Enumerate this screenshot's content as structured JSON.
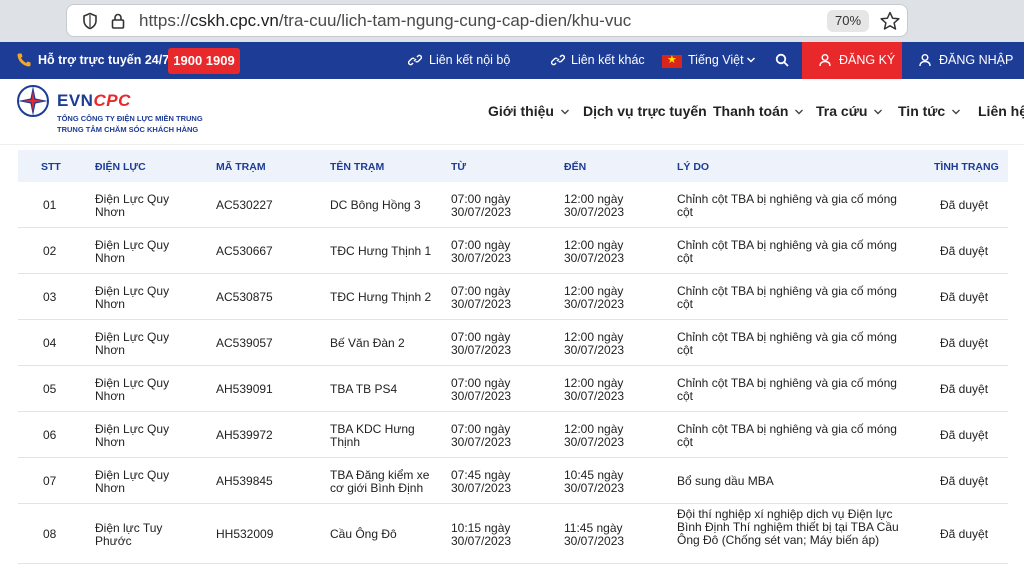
{
  "browser": {
    "url_prefix": "https://",
    "url_host": "cskh.cpc.vn",
    "url_path": "/tra-cuu/lich-tam-ngung-cung-cap-dien/khu-vuc",
    "zoom": "70%"
  },
  "topbar": {
    "support_label": "Hỗ trợ trực tuyến 24/7:",
    "hotline": "1900 1909",
    "internal_link": "Liên kết nội bộ",
    "other_link": "Liên kết khác",
    "language": "Tiếng Việt",
    "register": "ĐĂNG KÝ",
    "login": "ĐĂNG NHẬP"
  },
  "logo": {
    "evn": "EVN",
    "cpc": "CPC",
    "line1": "TỔNG CÔNG TY ĐIỆN LỰC MIỀN TRUNG",
    "line2": "TRUNG TÂM CHĂM SÓC KHÁCH HÀNG"
  },
  "nav": [
    {
      "label": "Giới thiệu"
    },
    {
      "label": "Dịch vụ trực tuyến"
    },
    {
      "label": "Thanh toán"
    },
    {
      "label": "Tra cứu"
    },
    {
      "label": "Tin tức"
    },
    {
      "label": "Liên hệ"
    }
  ],
  "table": {
    "headers": [
      "STT",
      "ĐIỆN LỰC",
      "MÃ TRẠM",
      "TÊN TRẠM",
      "TỪ",
      "ĐẾN",
      "LÝ DO",
      "TÌNH TRẠNG"
    ],
    "rows": [
      {
        "stt": "01",
        "dl1": "Điện Lực Quy",
        "dl2": "Nhơn",
        "ma": "AC530227",
        "ten1": "DC Bông Hồng 3",
        "ten2": "",
        "tu1": "07:00 ngày",
        "tu2": "30/07/2023",
        "den1": "12:00 ngày",
        "den2": "30/07/2023",
        "ld1": "Chỉnh cột TBA bị nghiêng và gia cố móng",
        "ld2": "cột",
        "ld3": "",
        "tt": "Đã duyệt"
      },
      {
        "stt": "02",
        "dl1": "Điện Lực Quy",
        "dl2": "Nhơn",
        "ma": "AC530667",
        "ten1": "TĐC Hưng Thịnh 1",
        "ten2": "",
        "tu1": "07:00 ngày",
        "tu2": "30/07/2023",
        "den1": "12:00 ngày",
        "den2": "30/07/2023",
        "ld1": "Chỉnh cột TBA bị nghiêng và gia cố móng",
        "ld2": "cột",
        "ld3": "",
        "tt": "Đã duyệt"
      },
      {
        "stt": "03",
        "dl1": "Điện Lực Quy",
        "dl2": "Nhơn",
        "ma": "AC530875",
        "ten1": "TĐC Hưng Thịnh 2",
        "ten2": "",
        "tu1": "07:00 ngày",
        "tu2": "30/07/2023",
        "den1": "12:00 ngày",
        "den2": "30/07/2023",
        "ld1": "Chỉnh cột TBA bị nghiêng và gia cố móng",
        "ld2": "cột",
        "ld3": "",
        "tt": "Đã duyệt"
      },
      {
        "stt": "04",
        "dl1": "Điện Lực Quy",
        "dl2": "Nhơn",
        "ma": "AC539057",
        "ten1": "Bế Văn Đàn 2",
        "ten2": "",
        "tu1": "07:00 ngày",
        "tu2": "30/07/2023",
        "den1": "12:00 ngày",
        "den2": "30/07/2023",
        "ld1": "Chỉnh cột TBA bị nghiêng và gia cố móng",
        "ld2": "cột",
        "ld3": "",
        "tt": "Đã duyệt"
      },
      {
        "stt": "05",
        "dl1": "Điện Lực Quy",
        "dl2": "Nhơn",
        "ma": "AH539091",
        "ten1": "TBA TB PS4",
        "ten2": "",
        "tu1": "07:00 ngày",
        "tu2": "30/07/2023",
        "den1": "12:00 ngày",
        "den2": "30/07/2023",
        "ld1": "Chỉnh cột TBA bị nghiêng và gia cố móng",
        "ld2": "cột",
        "ld3": "",
        "tt": "Đã duyệt"
      },
      {
        "stt": "06",
        "dl1": "Điện Lực Quy",
        "dl2": "Nhơn",
        "ma": "AH539972",
        "ten1": "TBA KDC Hưng",
        "ten2": "Thịnh",
        "tu1": "07:00 ngày",
        "tu2": "30/07/2023",
        "den1": "12:00 ngày",
        "den2": "30/07/2023",
        "ld1": "Chỉnh cột TBA bị nghiêng và gia cố móng",
        "ld2": "cột",
        "ld3": "",
        "tt": "Đã duyệt"
      },
      {
        "stt": "07",
        "dl1": "Điện Lực Quy",
        "dl2": "Nhơn",
        "ma": "AH539845",
        "ten1": "TBA Đăng kiểm xe",
        "ten2": "cơ giới Bình Định",
        "tu1": "07:45 ngày",
        "tu2": "30/07/2023",
        "den1": "10:45 ngày",
        "den2": "30/07/2023",
        "ld1": "Bổ sung dầu MBA",
        "ld2": "",
        "ld3": "",
        "tt": "Đã duyệt"
      },
      {
        "stt": "08",
        "dl1": "Điện lực Tuy",
        "dl2": "Phước",
        "ma": "HH532009",
        "ten1": "Cầu Ông Đô",
        "ten2": "",
        "tu1": "10:15 ngày",
        "tu2": "30/07/2023",
        "den1": "11:45 ngày",
        "den2": "30/07/2023",
        "ld1": "Đội thí nghiệp xí nghiệp dịch vụ Điện lực",
        "ld2": "Bình Định Thí nghiệm thiết bị tại TBA Cầu",
        "ld3": "Ông Đô (Chống sét van; Máy biến áp)",
        "tt": "Đã duyệt"
      }
    ]
  }
}
